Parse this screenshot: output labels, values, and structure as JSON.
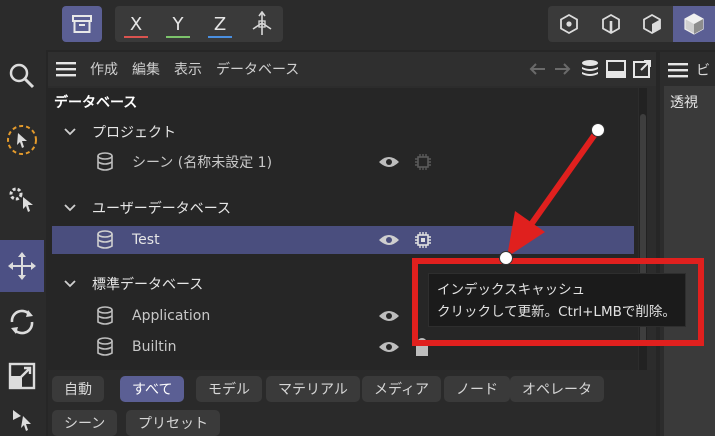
{
  "toolbar": {
    "axes": [
      {
        "label": "X",
        "color": "#d9534f"
      },
      {
        "label": "Y",
        "color": "#7cc36b"
      },
      {
        "label": "Z",
        "color": "#4a8fe0"
      }
    ]
  },
  "panel": {
    "menu": [
      "作成",
      "編集",
      "表示",
      "データベース"
    ],
    "tree_title": "データベース",
    "groups": [
      {
        "label": "プロジェクト",
        "items": [
          {
            "label": "シーン (名称未設定 1)"
          }
        ]
      },
      {
        "label": "ユーザーデータベース",
        "items": [
          {
            "label": "Test",
            "selected": true
          }
        ]
      },
      {
        "label": "標準データベース",
        "items": [
          {
            "label": "Application"
          },
          {
            "label": "Builtin"
          }
        ]
      }
    ]
  },
  "filters": {
    "row1": [
      "自動",
      "すべて",
      "モデル",
      "マテリアル",
      "メディア",
      "ノード",
      "オペレータ"
    ],
    "row2": [
      "シーン",
      "プリセット"
    ],
    "active": "すべて"
  },
  "right_panel": {
    "menu_label": "ビ",
    "view_label": "透視"
  },
  "tooltip": {
    "line1": "インデックスキャッシュ",
    "line2": "クリックして更新。Ctrl+LMBで削除。"
  },
  "colors": {
    "accent": "#5b5f94",
    "selection": "#4a4e7e",
    "annotation": "#e0201e"
  }
}
